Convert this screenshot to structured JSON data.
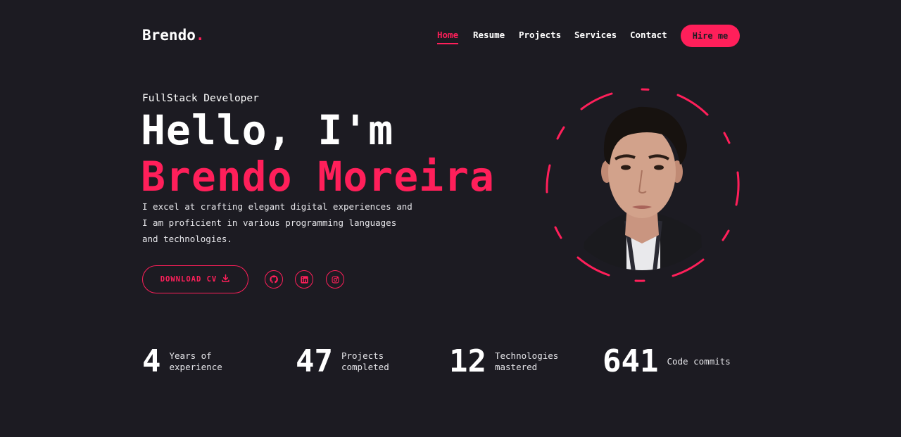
{
  "brand": {
    "name": "Brendo",
    "dot": "."
  },
  "nav": {
    "items": [
      {
        "label": "Home",
        "active": true
      },
      {
        "label": "Resume",
        "active": false
      },
      {
        "label": "Projects",
        "active": false
      },
      {
        "label": "Services",
        "active": false
      },
      {
        "label": "Contact",
        "active": false
      }
    ],
    "cta": "Hire me"
  },
  "hero": {
    "role": "FullStack Developer",
    "greeting": "Hello, I'm",
    "name": "Brendo Moreira",
    "description": "I excel at crafting elegant digital experiences and I am proficient in various programming languages and technologies.",
    "download_label": "DOWNLOAD CV",
    "download_icon": "download-icon",
    "socials": [
      {
        "icon": "github-icon"
      },
      {
        "icon": "linkedin-icon"
      },
      {
        "icon": "instagram-icon"
      }
    ]
  },
  "stats": [
    {
      "number": "4",
      "label": "Years of experience"
    },
    {
      "number": "47",
      "label": "Projects completed"
    },
    {
      "number": "12",
      "label": "Technologies mastered"
    },
    {
      "number": "641",
      "label": "Code commits"
    }
  ],
  "colors": {
    "accent": "#ff1f5a",
    "background": "#1c1b22",
    "text": "#ffffff"
  }
}
